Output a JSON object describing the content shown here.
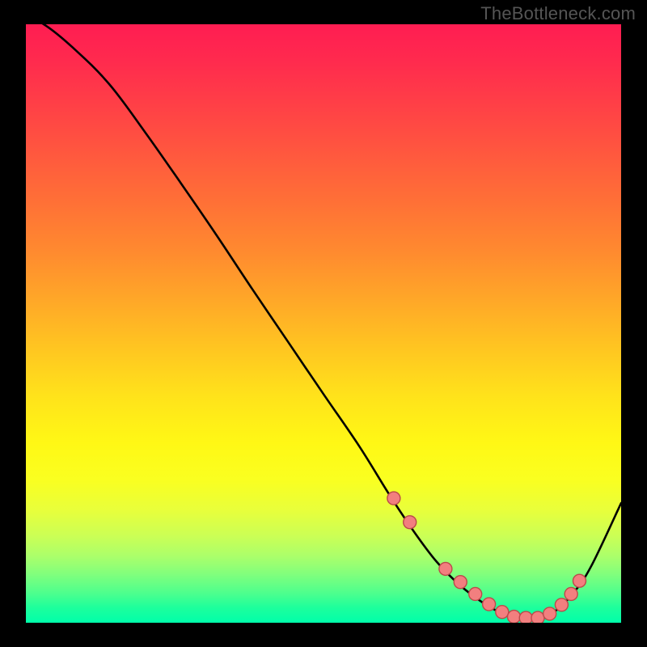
{
  "watermark": "TheBottleneck.com",
  "chart_data": {
    "type": "line",
    "title": "",
    "xlabel": "",
    "ylabel": "",
    "xlim": [
      0,
      100
    ],
    "ylim": [
      0,
      100
    ],
    "series": [
      {
        "name": "curve",
        "x": [
          0,
          3,
          8,
          14,
          20,
          26,
          32,
          38,
          44,
          50,
          56,
          61,
          65,
          69,
          73,
          77,
          80,
          83,
          86,
          89,
          92,
          95,
          100
        ],
        "values": [
          101,
          100,
          96,
          90,
          82,
          73.5,
          64.8,
          55.8,
          47,
          38.2,
          29.5,
          21.5,
          15.5,
          10.2,
          6.2,
          3.2,
          1.6,
          0.8,
          0.8,
          2.0,
          5.0,
          9.5,
          20
        ]
      }
    ],
    "markers": {
      "color": "#f27f7f",
      "border": "#bb4a4a",
      "radius": 8,
      "x": [
        61.8,
        64.5,
        70.5,
        73.0,
        75.5,
        77.8,
        80.0,
        82.0,
        84.0,
        86.0,
        88.0,
        90.0,
        91.6,
        93.0
      ],
      "values": [
        20.8,
        16.8,
        9.0,
        6.8,
        4.8,
        3.1,
        1.8,
        1.0,
        0.8,
        0.8,
        1.5,
        3.0,
        4.8,
        7.0
      ]
    },
    "gradient": {
      "top": "#ff1d52",
      "bottom": "#00ffaa"
    }
  }
}
